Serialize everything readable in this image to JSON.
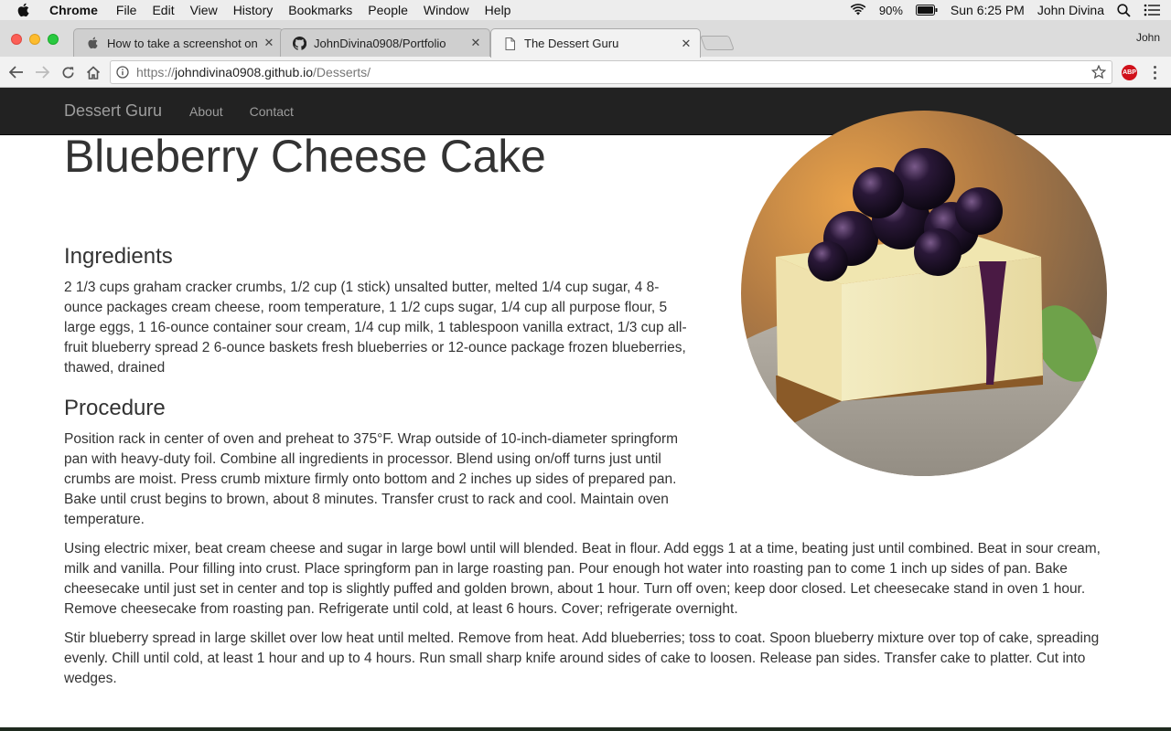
{
  "menubar": {
    "app": "Chrome",
    "items": [
      "File",
      "Edit",
      "View",
      "History",
      "Bookmarks",
      "People",
      "Window",
      "Help"
    ],
    "battery": "90%",
    "clock": "Sun 6:25 PM",
    "user": "John Divina"
  },
  "tabs": [
    {
      "title": "How to take a screenshot on y",
      "icon": "apple-icon"
    },
    {
      "title": "JohnDivina0908/Portfolio",
      "icon": "github-icon"
    },
    {
      "title": "The Dessert Guru",
      "icon": "page-icon"
    }
  ],
  "profile_name": "John",
  "address_bar": {
    "scheme": "https://",
    "host": "johndivina0908.github.io",
    "path": "/Desserts/"
  },
  "extension_badge": "ABP",
  "navbar": {
    "brand": "Dessert Guru",
    "links": [
      "About",
      "Contact"
    ]
  },
  "recipe": {
    "title": "Blueberry Cheese Cake",
    "ingredients_heading": "Ingredients",
    "ingredients": "2 1/3 cups graham cracker crumbs, 1/2 cup (1 stick) unsalted butter, melted 1/4 cup sugar, 4 8-ounce packages cream cheese, room temperature, 1 1/2 cups sugar, 1/4 cup all purpose flour, 5 large eggs, 1 16-ounce container sour cream, 1/4 cup milk, 1 tablespoon vanilla extract, 1/3 cup all-fruit blueberry spread 2 6-ounce baskets fresh blueberries or 12-ounce package frozen blueberries, thawed, drained",
    "procedure_heading": "Procedure",
    "procedure": [
      "Position rack in center of oven and preheat to 375°F. Wrap outside of 10-inch-diameter springform pan with heavy-duty foil. Combine all ingredients in processor. Blend using on/off turns just until crumbs are moist. Press crumb mixture firmly onto bottom and 2 inches up sides of prepared pan. Bake until crust begins to brown, about 8 minutes. Transfer crust to rack and cool. Maintain oven temperature.",
      "Using electric mixer, beat cream cheese and sugar in large bowl until will blended. Beat in flour. Add eggs 1 at a time, beating just until combined. Beat in sour cream, milk and vanilla. Pour filling into crust. Place springform pan in large roasting pan. Pour enough hot water into roasting pan to come 1 inch up sides of pan. Bake cheesecake until just set in center and top is slightly puffed and golden brown, about 1 hour. Turn off oven; keep door closed. Let cheesecake stand in oven 1 hour. Remove cheesecake from roasting pan. Refrigerate until cold, at least 6 hours. Cover; refrigerate overnight.",
      "Stir blueberry spread in large skillet over low heat until melted. Remove from heat. Add blueberries; toss to coat. Spoon blueberry mixture over top of cake, spreading evenly. Chill until cold, at least 1 hour and up to 4 hours. Run small sharp knife around sides of cake to loosen. Release pan sides. Transfer cake to platter. Cut into wedges."
    ]
  }
}
